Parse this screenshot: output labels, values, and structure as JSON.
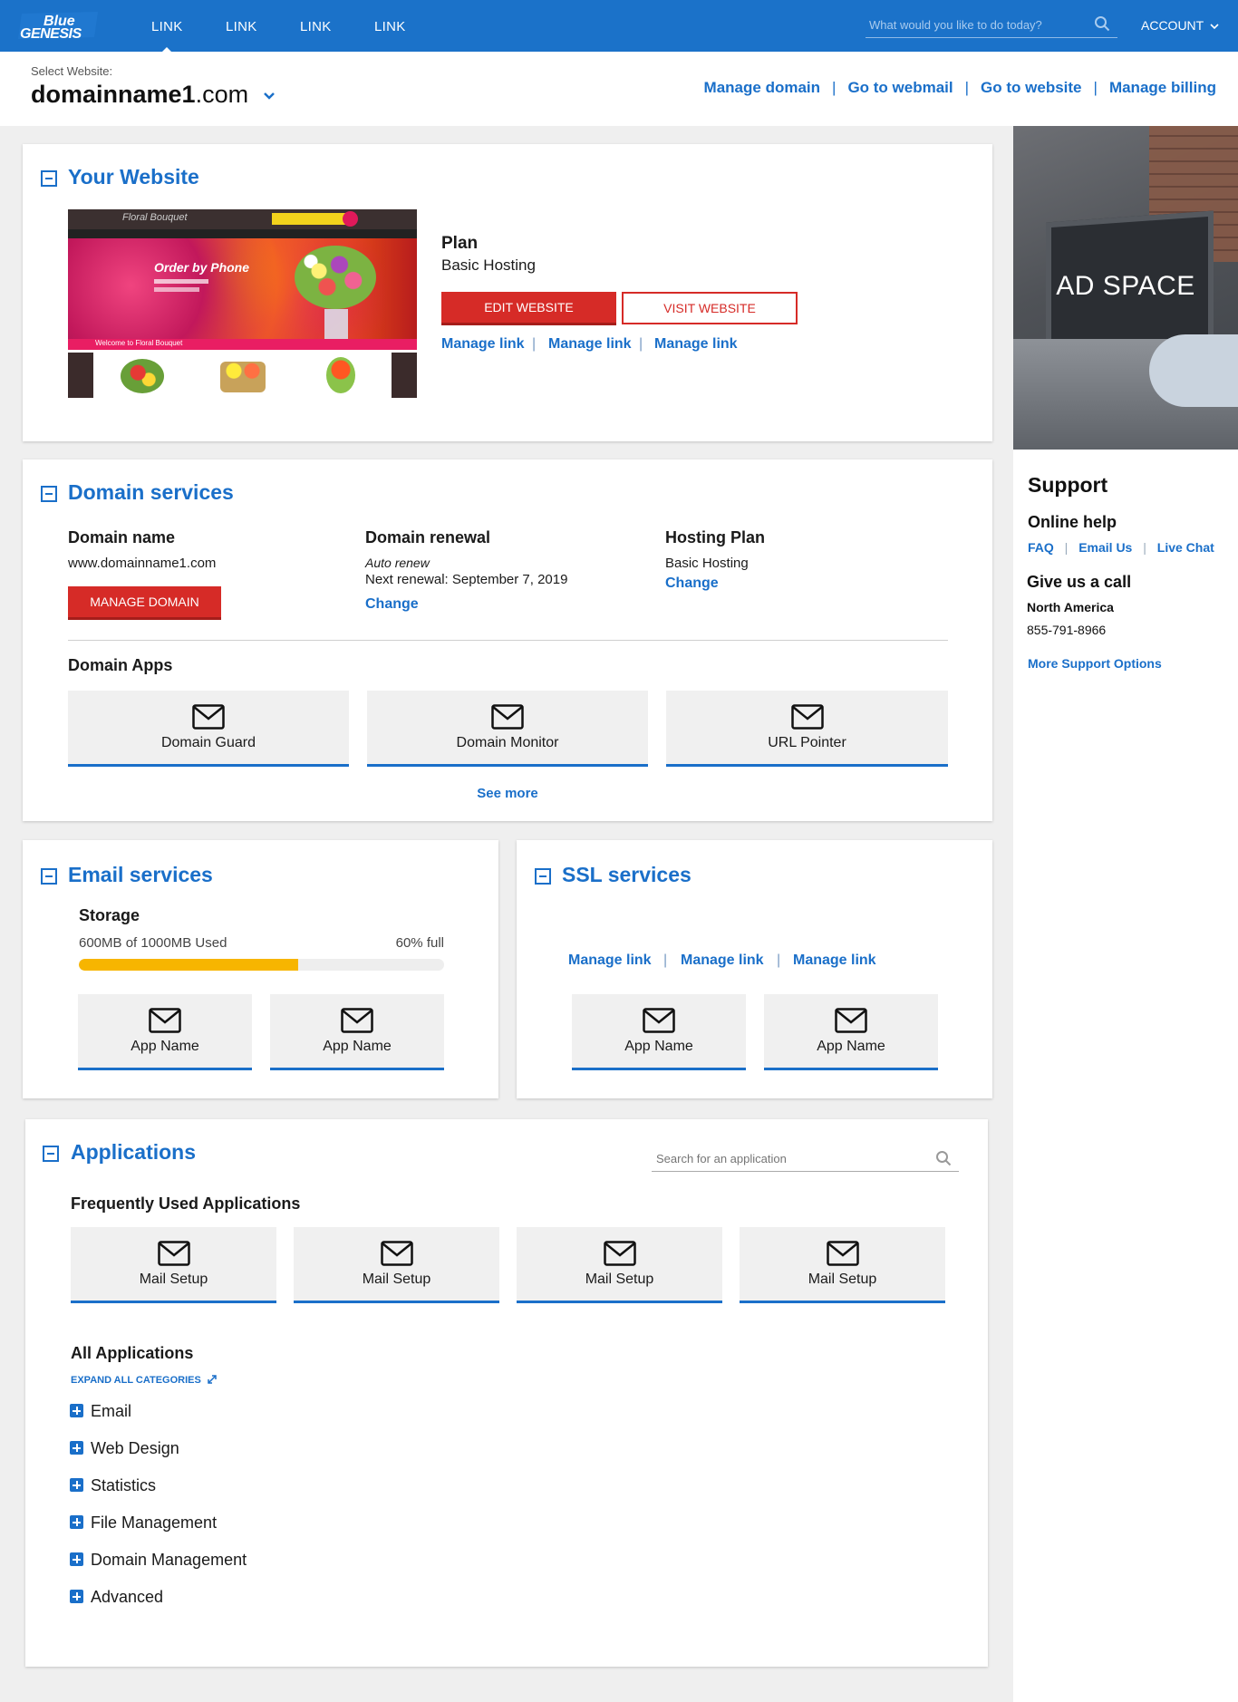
{
  "brand": {
    "logo_text": "Blue GENESIS"
  },
  "topnav": {
    "links": [
      "LINK",
      "LINK",
      "LINK",
      "LINK"
    ],
    "search_placeholder": "What would you like to do today?",
    "account_label": "ACCOUNT"
  },
  "site_selector": {
    "label": "Select Website:",
    "domain_name": "domainname1",
    "domain_tld": ".com"
  },
  "quick_links": [
    "Manage domain",
    "Go to webmail",
    "Go to website",
    "Manage billing"
  ],
  "your_website": {
    "title": "Your Website",
    "plan_heading": "Plan",
    "plan_value": "Basic Hosting",
    "edit_button": "EDIT WEBSITE",
    "visit_button": "VISIT WEBSITE",
    "manage_links": [
      "Manage link",
      "Manage link",
      "Manage link"
    ],
    "preview": {
      "brand": "Floral Bouquet",
      "headline": "Order by Phone",
      "banner": "Welcome to Floral Bouquet"
    }
  },
  "domain_services": {
    "title": "Domain services",
    "domain_name_heading": "Domain name",
    "domain_name_value": "www.domainname1.com",
    "manage_button": "MANAGE DOMAIN",
    "renewal_heading": "Domain renewal",
    "renewal_mode": "Auto renew",
    "renewal_next": "Next renewal: September 7, 2019",
    "renewal_change": "Change",
    "hosting_heading": "Hosting Plan",
    "hosting_value": "Basic Hosting",
    "hosting_change": "Change",
    "apps_heading": "Domain Apps",
    "apps": [
      "Domain Guard",
      "Domain Monitor",
      "URL Pointer"
    ],
    "see_more": "See more"
  },
  "email_services": {
    "title": "Email services",
    "storage_heading": "Storage",
    "storage_used": "600MB of 1000MB Used",
    "storage_percent_label": "60% full",
    "storage_fraction": 0.6,
    "apps": [
      "App Name",
      "App Name"
    ]
  },
  "ssl_services": {
    "title": "SSL services",
    "manage_links": [
      "Manage link",
      "Manage link",
      "Manage link"
    ],
    "apps": [
      "App Name",
      "App Name"
    ]
  },
  "applications": {
    "title": "Applications",
    "search_placeholder": "Search for an application",
    "frequent_heading": "Frequently Used Applications",
    "frequent": [
      "Mail Setup",
      "Mail Setup",
      "Mail Setup",
      "Mail Setup"
    ],
    "all_heading": "All Applications",
    "expand_label": "EXPAND ALL CATEGORIES",
    "categories": [
      "Email",
      "Web Design",
      "Statistics",
      "File Management",
      "Domain Management",
      "Advanced"
    ]
  },
  "ad": {
    "text": "AD SPACE"
  },
  "support": {
    "title": "Support",
    "online_help_heading": "Online help",
    "online_links": [
      "FAQ",
      "Email Us",
      "Live Chat"
    ],
    "call_heading": "Give us a call",
    "region": "North America",
    "phone": "855-791-8966",
    "more_link": "More Support Options"
  },
  "colors": {
    "primary_blue": "#1b72c9",
    "link_blue": "#1a6fc9",
    "action_red": "#d62b27",
    "progress_yellow": "#f7b500",
    "page_gray": "#efefef",
    "tile_gray": "#f0f0f0"
  }
}
